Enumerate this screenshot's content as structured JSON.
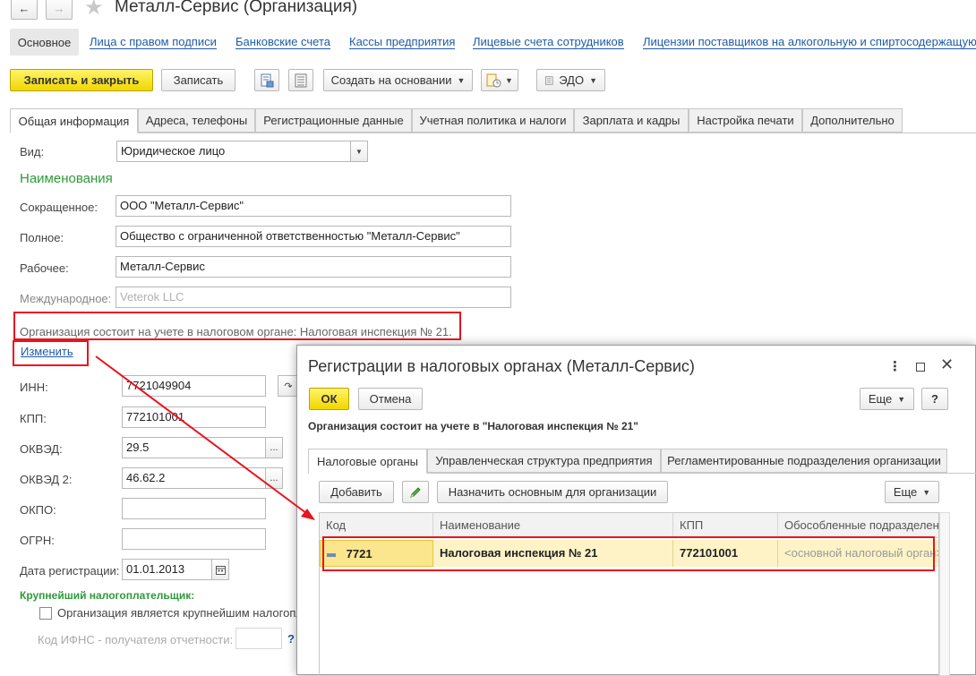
{
  "window": {
    "title": "Металл-Сервис (Организация)"
  },
  "section_links": [
    "Основное",
    "Лица с правом подписи",
    "Банковские счета",
    "Кассы предприятия",
    "Лицевые счета сотрудников",
    "Лицензии поставщиков на алкогольную и спиртосодержащую"
  ],
  "toolbar": {
    "save_close": "Записать и закрыть",
    "save": "Записать",
    "create_based": "Создать на основании",
    "edo": "ЭДО"
  },
  "tabs": [
    "Общая информация",
    "Адреса, телефоны",
    "Регистрационные данные",
    "Учетная политика и налоги",
    "Зарплата и кадры",
    "Настройка печати",
    "Дополнительно"
  ],
  "form": {
    "vid_label": "Вид:",
    "vid_value": "Юридическое лицо",
    "names_heading": "Наименования",
    "short_label": "Сокращенное:",
    "short_value": "ООО \"Металл-Сервис\"",
    "full_label": "Полное:",
    "full_value": "Общество с ограниченной ответственностью \"Металл-Сервис\"",
    "work_label": "Рабочее:",
    "work_value": "Металл-Сервис",
    "intl_label": "Международное:",
    "intl_placeholder": "Veterok LLC",
    "tax_note": "Организация состоит на учете в налоговом органе: Налоговая инспекция № 21.",
    "change_link": "Изменить",
    "inn_label": "ИНН:",
    "inn_value": "7721049904",
    "kpp_label": "КПП:",
    "kpp_value": "772101001",
    "okved_label": "ОКВЭД:",
    "okved_value": "29.5",
    "okved2_label": "ОКВЭД 2:",
    "okved2_value": "46.62.2",
    "okpo_label": "ОКПО:",
    "okpo_value": "",
    "ogrn_label": "ОГРН:",
    "ogrn_value": "",
    "regdate_label": "Дата регистрации:",
    "regdate_value": "01.01.2013",
    "largest_heading": "Крупнейший налогоплательщик:",
    "largest_checkbox": "Организация является крупнейшим налогопл",
    "ifns_label": "Код ИФНС - получателя отчетности:",
    "ifns_help": "?"
  },
  "dialog": {
    "title": "Регистрации в налоговых органах (Металл-Сервис)",
    "ok": "ОК",
    "cancel": "Отмена",
    "more": "Еще",
    "help": "?",
    "subtitle": "Организация состоит на учете в \"Налоговая инспекция № 21\"",
    "tabs": [
      "Налоговые органы",
      "Управленческая структура предприятия",
      "Регламентированные подразделения организации"
    ],
    "add": "Добавить",
    "set_main": "Назначить основным для организации",
    "more2": "Еще",
    "columns": [
      "Код",
      "Наименование",
      "КПП",
      "Обособленные подразделен"
    ],
    "rows": [
      {
        "code": "7721",
        "name": "Налоговая инспекция № 21",
        "kpp": "772101001",
        "subdivision": "<основной налоговый орган>"
      }
    ]
  },
  "colors": {
    "highlight_red": "#e8141e",
    "link_blue": "#1e5ba8",
    "heading_green": "#2e9a3a",
    "primary_yellow": "#f5de1c",
    "selected_row": "#fdf3c7"
  }
}
